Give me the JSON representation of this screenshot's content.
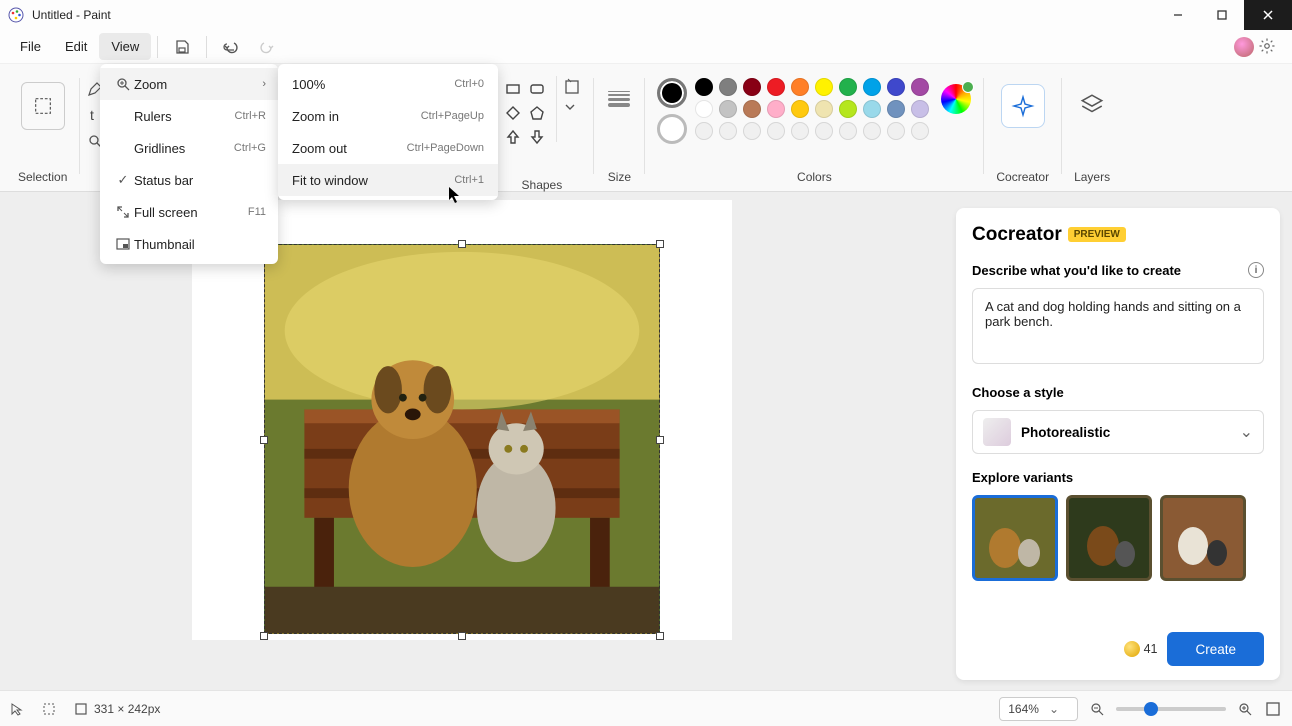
{
  "title": "Untitled - Paint",
  "menu": {
    "file": "File",
    "edit": "Edit",
    "view": "View"
  },
  "view_menu": {
    "zoom": "Zoom",
    "rulers": {
      "label": "Rulers",
      "shortcut": "Ctrl+R"
    },
    "gridlines": {
      "label": "Gridlines",
      "shortcut": "Ctrl+G"
    },
    "statusbar": "Status bar",
    "fullscreen": {
      "label": "Full screen",
      "shortcut": "F11"
    },
    "thumbnail": "Thumbnail"
  },
  "zoom_submenu": {
    "z100": {
      "label": "100%",
      "shortcut": "Ctrl+0"
    },
    "zin": {
      "label": "Zoom in",
      "shortcut": "Ctrl+PageUp"
    },
    "zout": {
      "label": "Zoom out",
      "shortcut": "Ctrl+PageDown"
    },
    "zfit": {
      "label": "Fit to window",
      "shortcut": "Ctrl+1"
    }
  },
  "ribbon": {
    "selection": "Selection",
    "shapes": "Shapes",
    "size": "Size",
    "colors": "Colors",
    "cocreator": "Cocreator",
    "layers": "Layers"
  },
  "palette": {
    "row1": [
      "#000000",
      "#7f7f7f",
      "#880015",
      "#ed1c24",
      "#ff7f27",
      "#fff200",
      "#22b14c",
      "#00a2e8",
      "#3f48cc",
      "#a349a4"
    ],
    "row2": [
      "#ffffff",
      "#c3c3c3",
      "#b97a57",
      "#ffaec9",
      "#ffc90e",
      "#efe4b0",
      "#b5e61d",
      "#99d9ea",
      "#7092be",
      "#c8bfe7"
    ],
    "row3": [
      "#f0f0f0",
      "#f0f0f0",
      "#f0f0f0",
      "#f0f0f0",
      "#f0f0f0",
      "#f0f0f0",
      "#f0f0f0",
      "#f0f0f0",
      "#f0f0f0",
      "#f0f0f0"
    ]
  },
  "cocreator": {
    "title": "Cocreator",
    "badge": "PREVIEW",
    "describe_label": "Describe what you'd like to create",
    "prompt": "A cat and dog holding hands and sitting on a park bench.",
    "style_label": "Choose a style",
    "style_value": "Photorealistic",
    "variants_label": "Explore variants",
    "credits": "41",
    "create": "Create"
  },
  "status": {
    "dimensions": "331 × 242px",
    "zoom": "164%"
  }
}
